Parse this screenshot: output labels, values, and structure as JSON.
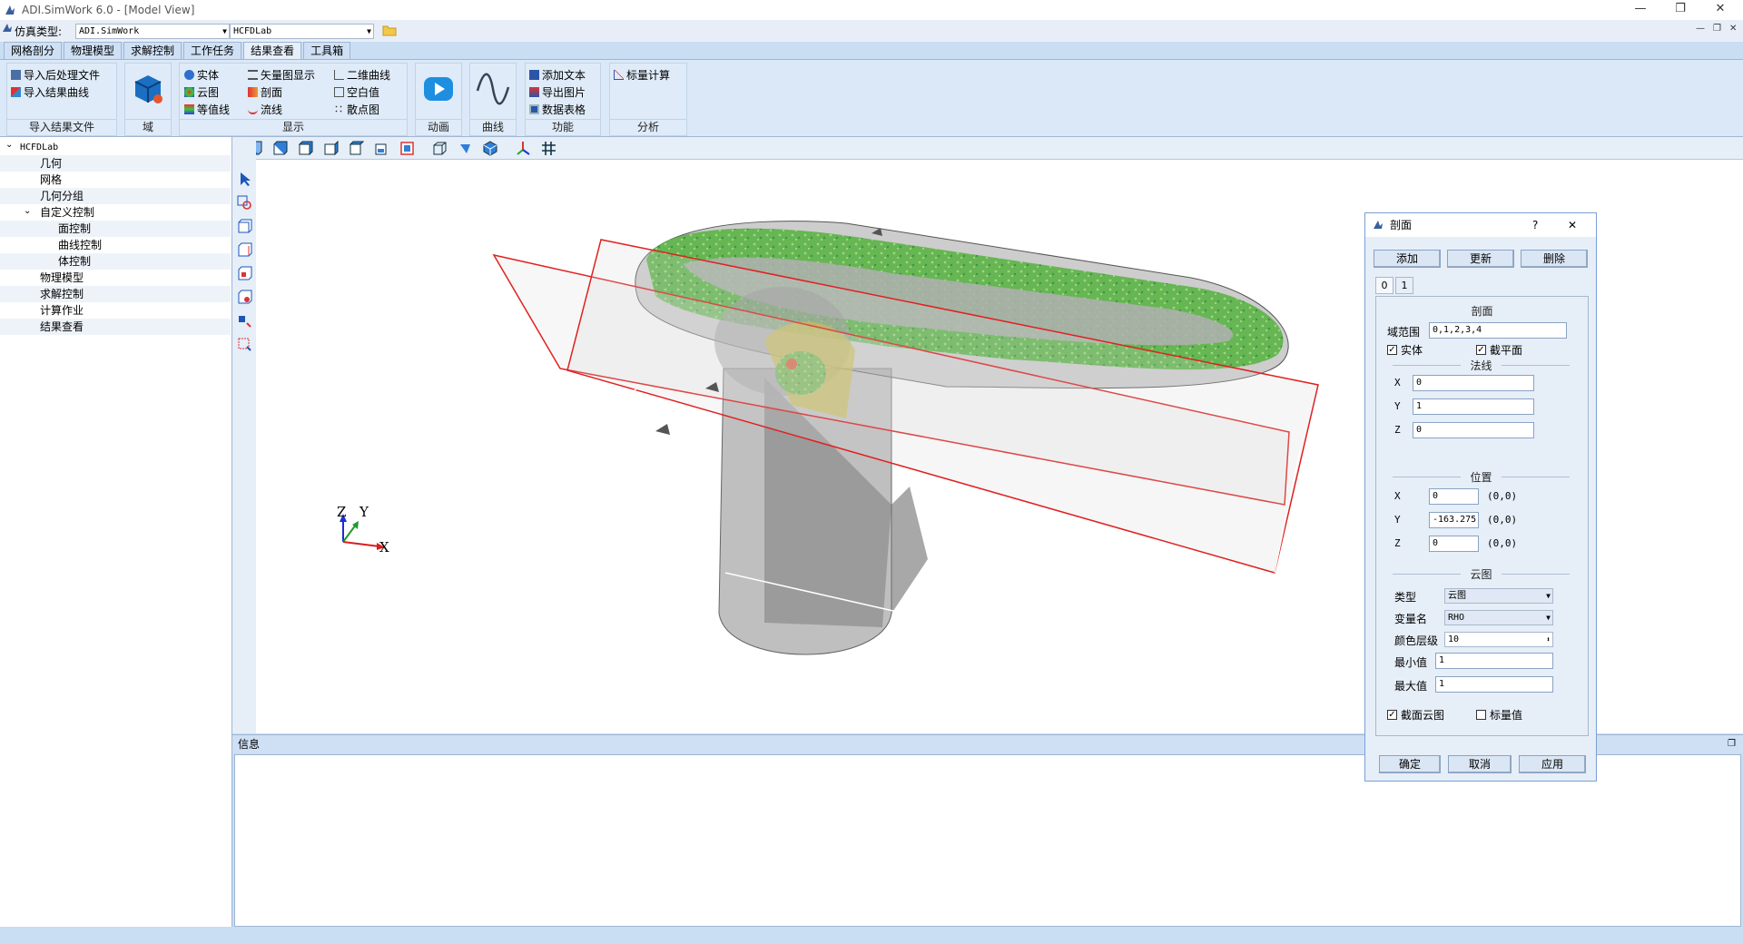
{
  "window": {
    "title": "ADI.SimWork 6.0 - [Model View]",
    "minimize": "—",
    "restore": "❐",
    "close": "✕"
  },
  "menubar": {
    "sim_type_label": "仿真类型:",
    "sim_type_value": "ADI.SimWork",
    "project_value": "HCFDLab"
  },
  "tabs": [
    "网格剖分",
    "物理模型",
    "求解控制",
    "工作任务",
    "结果查看",
    "工具箱"
  ],
  "active_tab": "结果查看",
  "ribbon": {
    "import": {
      "items": [
        "导入后处理文件",
        "导入结果曲线"
      ],
      "label": "导入结果文件"
    },
    "domain": {
      "label": "域"
    },
    "display": {
      "col1": [
        "实体",
        "云图",
        "等值线"
      ],
      "col2": [
        "矢量图显示",
        "剖面",
        "流线"
      ],
      "col3": [
        "二维曲线",
        "空白值",
        "散点图"
      ],
      "label": "显示"
    },
    "animation": {
      "label": "动画"
    },
    "curve": {
      "label": "曲线"
    },
    "function": {
      "items": [
        "添加文本",
        "导出图片",
        "数据表格"
      ],
      "label": "功能"
    },
    "analysis": {
      "items": [
        "标量计算"
      ],
      "label": "分析"
    }
  },
  "tree": {
    "root": "HCFDLab",
    "items": [
      "几何",
      "网格",
      "几何分组",
      "自定义控制",
      "面控制",
      "曲线控制",
      "体控制",
      "物理模型",
      "求解控制",
      "计算作业",
      "结果查看"
    ]
  },
  "axes": {
    "z": "Z",
    "y": "Y",
    "x": "X"
  },
  "info": {
    "title": "信息"
  },
  "dialog": {
    "title": "剖面",
    "help": "?",
    "close": "✕",
    "add": "添加",
    "update": "更新",
    "delete": "删除",
    "tabs": [
      "0",
      "1"
    ],
    "section_title": "剖面",
    "domain_label": "域范围",
    "domain_value": "0,1,2,3,4",
    "solid_label": "实体",
    "cutplane_label": "截平面",
    "normal_title": "法线",
    "normal": {
      "x_label": "X",
      "x": "0",
      "y_label": "Y",
      "y": "1",
      "z_label": "Z",
      "z": "0"
    },
    "position_title": "位置",
    "position": {
      "x_label": "X",
      "x": "0",
      "x_range": "(0,0)",
      "y_label": "Y",
      "y": "-163.275",
      "y_range": "(0,0)",
      "z_label": "Z",
      "z": "0",
      "z_range": "(0,0)"
    },
    "contour_title": "云图",
    "type_label": "类型",
    "type_value": "云图",
    "var_label": "变量名",
    "var_value": "RHO",
    "levels_label": "颜色层级",
    "levels_value": "10",
    "min_label": "最小值",
    "min_value": "1",
    "max_label": "最大值",
    "max_value": "1",
    "section_contour_label": "截面云图",
    "scalar_label": "标量值",
    "ok": "确定",
    "cancel": "取消",
    "apply": "应用"
  }
}
